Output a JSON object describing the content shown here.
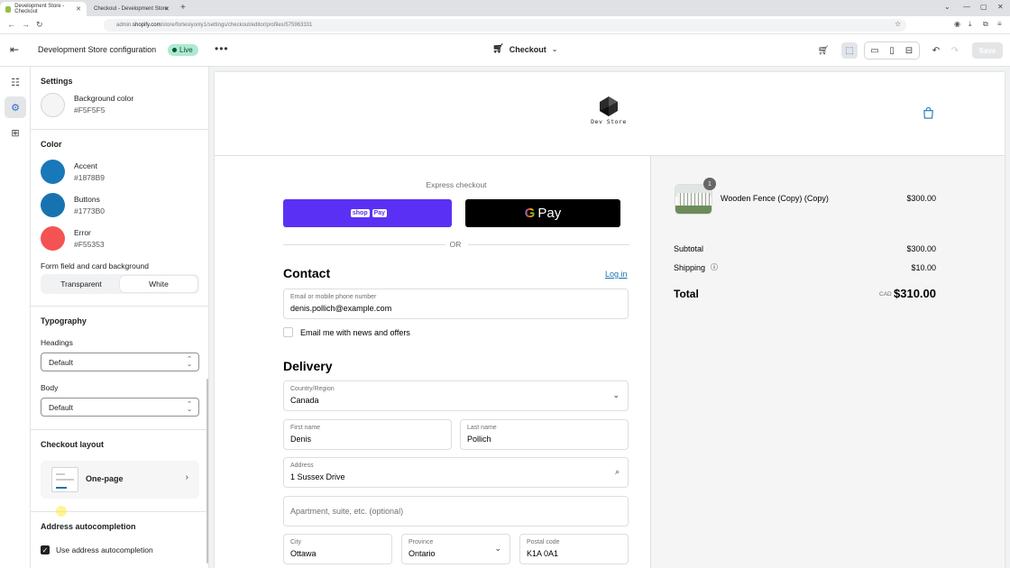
{
  "browser": {
    "tabs": [
      {
        "title": "Development Store - Checkout"
      },
      {
        "title": "Checkout - Development Store"
      }
    ],
    "new_tab": "+",
    "url_prefix": "admin.",
    "url_host": "shopify.com",
    "url_path": "/store/forteslyonly1/settings/checkout/editor/profiles/575963331"
  },
  "topbar": {
    "store_title": "Development Store configuration",
    "status_badge": "Live",
    "page_selector": "Checkout",
    "save_label": "Save"
  },
  "settings": {
    "section_title": "Settings",
    "background": {
      "label": "Background color",
      "value": "#F5F5F5"
    },
    "color_heading": "Color",
    "colors": [
      {
        "name": "Accent",
        "hex": "#1878B9"
      },
      {
        "name": "Buttons",
        "hex": "#1773B0"
      },
      {
        "name": "Error",
        "hex": "#F55353"
      }
    ],
    "form_bg_label": "Form field and card background",
    "form_bg_options": [
      "Transparent",
      "White"
    ],
    "form_bg_selected": "White",
    "typography_heading": "Typography",
    "headings_label": "Headings",
    "headings_value": "Default",
    "body_label": "Body",
    "body_value": "Default",
    "checkout_layout_heading": "Checkout layout",
    "checkout_layout_value": "One-page",
    "address_heading": "Address autocompletion",
    "address_checkbox_label": "Use address autocompletion",
    "address_checkbox_checked": true
  },
  "preview": {
    "store_name": "Dev Store",
    "express_checkout": "Express checkout",
    "shop_pay": {
      "text": "shop",
      "badge": "Pay"
    },
    "gpay": {
      "g": "G",
      "text": "Pay"
    },
    "or_label": "OR",
    "contact": {
      "title": "Contact",
      "login_link": "Log in",
      "email_label": "Email or mobile phone number",
      "email_value": "denis.pollich@example.com",
      "news_label": "Email me with news and offers"
    },
    "delivery": {
      "title": "Delivery",
      "country_label": "Country/Region",
      "country_value": "Canada",
      "first_name_label": "First name",
      "first_name_value": "Denis",
      "last_name_label": "Last name",
      "last_name_value": "Pollich",
      "address_label": "Address",
      "address_value": "1 Sussex Drive",
      "apartment_placeholder": "Apartment, suite, etc. (optional)",
      "city_label": "City",
      "city_value": "Ottawa",
      "province_label": "Province",
      "province_value": "Ontario",
      "postal_label": "Postal code",
      "postal_value": "K1A 0A1"
    },
    "summary": {
      "item_quantity": "1",
      "item_name": "Wooden Fence (Copy) (Copy)",
      "item_price": "$300.00",
      "subtotal_label": "Subtotal",
      "subtotal_value": "$300.00",
      "shipping_label": "Shipping",
      "shipping_value": "$10.00",
      "total_label": "Total",
      "currency": "CAD",
      "total_value": "$310.00"
    }
  },
  "icons": [
    "exit-icon",
    "more-icon",
    "cart-icon",
    "chevron-down-icon",
    "inspector-icon",
    "desktop-icon",
    "mobile-icon",
    "fullscreen-icon",
    "undo-icon",
    "redo-icon",
    "sections-icon",
    "settings-gear-icon",
    "apps-icon",
    "bag-icon",
    "search-icon",
    "help-icon",
    "chevron-right-icon",
    "check-icon"
  ],
  "colors": {
    "accent": "#1878B9",
    "buttons": "#1773B0",
    "error": "#F55353",
    "background": "#F5F5F5",
    "live_badge": "#AEE9D1",
    "shop_pay": "#5A31F4"
  }
}
